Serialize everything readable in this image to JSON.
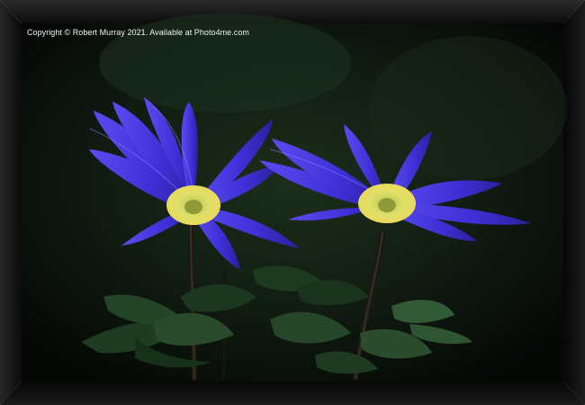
{
  "watermark": {
    "text": "Copyright © Robert Murray 2021. Available at Photo4me.com"
  },
  "colors": {
    "frame": "#121212",
    "petal": "#3b2fd1",
    "petal_highlight": "#7a6cff",
    "stamen": "#e4d85a",
    "background": "#0d170f",
    "foliage": "#1f3a20"
  }
}
